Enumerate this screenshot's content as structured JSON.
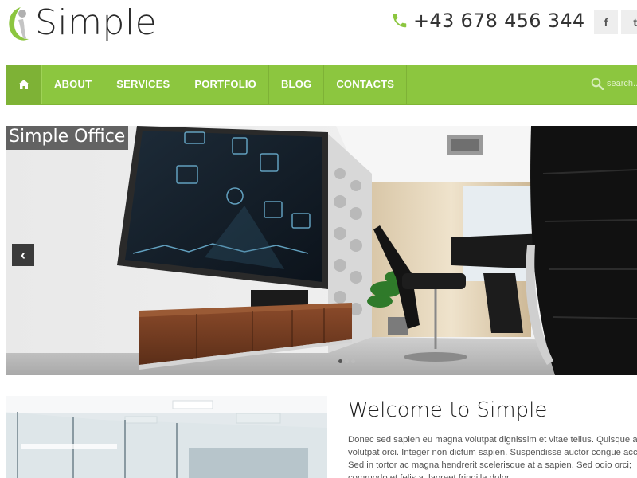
{
  "header": {
    "logo_text": "Simple",
    "phone": "+43 678 456 344",
    "social": [
      {
        "icon": "facebook-icon",
        "glyph": "f"
      },
      {
        "icon": "twitter-icon",
        "glyph": "t"
      }
    ]
  },
  "nav": {
    "home_icon": "home-icon",
    "items": [
      "ABOUT",
      "SERVICES",
      "PORTFOLIO",
      "BLOG",
      "CONTACTS"
    ],
    "search_placeholder": "search...",
    "colors": {
      "bar": "#8cc63f",
      "home": "#7eb236"
    }
  },
  "slider": {
    "caption": "Simple Office",
    "prev_glyph": "‹",
    "dots": 3,
    "active_dot": 1
  },
  "welcome": {
    "title": "Welcome to Simple",
    "lines": [
      "Donec sed sapien eu magna volutpat dignissim et vitae tellus. Quisque ac",
      "volutpat orci. Integer non dictum sapien. Suspendisse auctor congue accu",
      "Sed in tortor ac magna hendrerit scelerisque at a sapien. Sed odio orci;",
      "commodo et felis a, laoreet fringilla dolor."
    ]
  }
}
